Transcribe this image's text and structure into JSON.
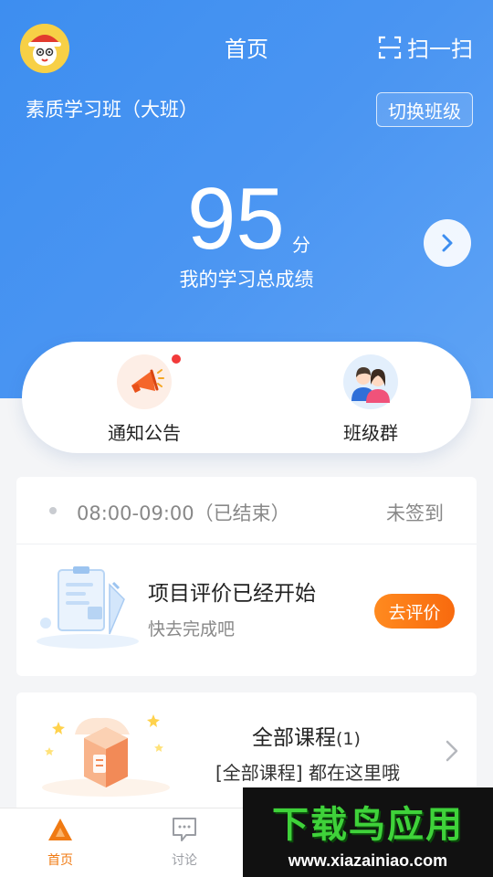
{
  "header": {
    "title": "首页",
    "scan_label": "扫一扫"
  },
  "class": {
    "name": "素质学习班（大班）",
    "switch_label": "切换班级"
  },
  "score": {
    "value": "95",
    "unit": "分",
    "label": "我的学习总成绩"
  },
  "quick_actions": [
    {
      "label": "通知公告",
      "icon": "megaphone-icon",
      "has_unread_dot": true
    },
    {
      "label": "班级群",
      "icon": "class-group-icon"
    }
  ],
  "schedule": {
    "time": "08:00-09:00",
    "status": "（已结束）",
    "signin_status": "未签到"
  },
  "evaluation": {
    "title": "项目评价已经开始",
    "subtitle": "快去完成吧",
    "button": "去评价"
  },
  "courses": {
    "title": "全部课程",
    "count": "(1)",
    "subtitle": "[全部课程] 都在这里哦"
  },
  "tabbar": [
    {
      "label": "首页",
      "icon": "home-icon",
      "active": true
    },
    {
      "label": "讨论",
      "icon": "discussion-icon",
      "active": false
    }
  ],
  "watermark": {
    "title": "下载鸟应用",
    "url": "www.xiazainiao.com"
  },
  "colors": {
    "primary_blue": "#3d8ef0",
    "accent_orange": "#f86a0e",
    "tab_active": "#f07a12"
  }
}
